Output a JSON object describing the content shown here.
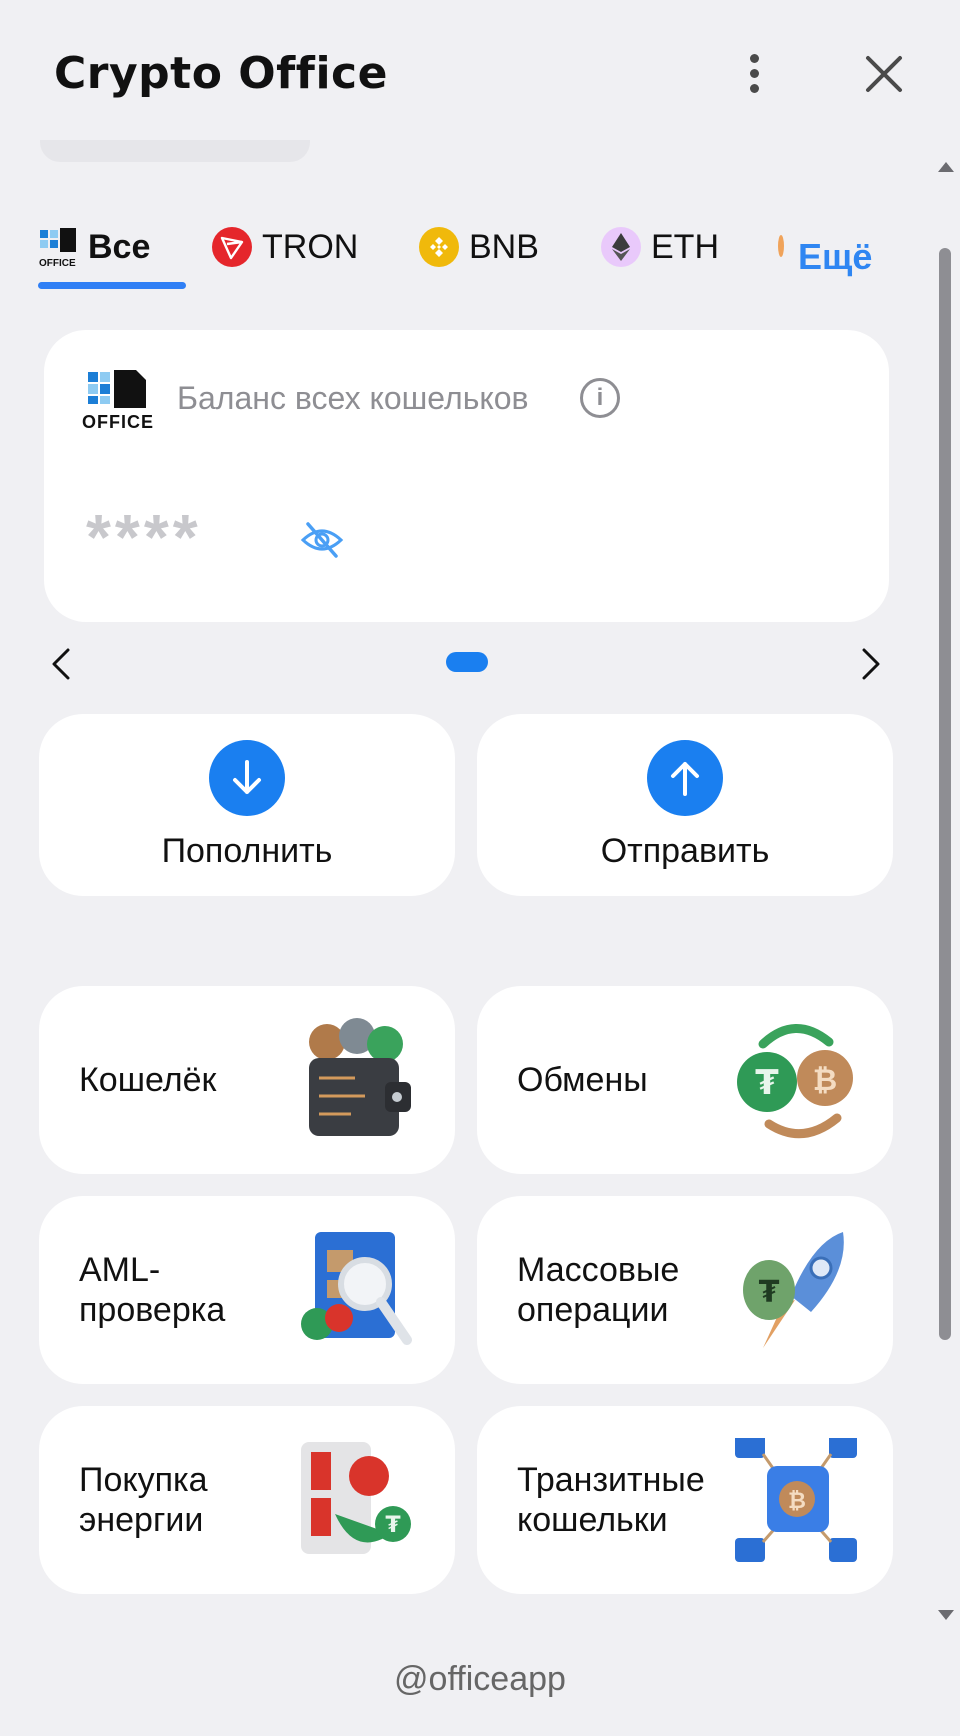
{
  "app": {
    "title": "Crypto Office"
  },
  "tabs": [
    {
      "label": "Все",
      "icon": "office-logo-icon",
      "active": true
    },
    {
      "label": "TRON",
      "icon": "tron-icon",
      "color": "#e5262b"
    },
    {
      "label": "BNB",
      "icon": "bnb-icon",
      "color": "#f0b90b"
    },
    {
      "label": "ETH",
      "icon": "eth-icon",
      "color": "#c99bf2"
    }
  ],
  "more_label": "Ещё",
  "balance": {
    "label": "Баланс всех кошельков",
    "masked_value": "****",
    "logo_text": "OFFICE"
  },
  "actions": [
    {
      "label": "Пополнить",
      "icon": "arrow-down-icon"
    },
    {
      "label": "Отправить",
      "icon": "arrow-up-icon"
    }
  ],
  "features": [
    {
      "line1": "Кошелёк",
      "line2": "",
      "icon": "wallet-icon"
    },
    {
      "line1": "Обмены",
      "line2": "",
      "icon": "exchange-icon"
    },
    {
      "line1": "AML-",
      "line2": "проверка",
      "icon": "aml-check-icon"
    },
    {
      "line1": "Массовые",
      "line2": "операции",
      "icon": "rocket-icon"
    },
    {
      "line1": "Покупка",
      "line2": "энергии",
      "icon": "energy-icon"
    },
    {
      "line1": "Транзитные",
      "line2": "кошельки",
      "icon": "transit-wallet-icon"
    }
  ],
  "footer": "@officeapp",
  "colors": {
    "accent": "#1a7ff0",
    "background": "#f0f0f3",
    "card": "#ffffff"
  }
}
